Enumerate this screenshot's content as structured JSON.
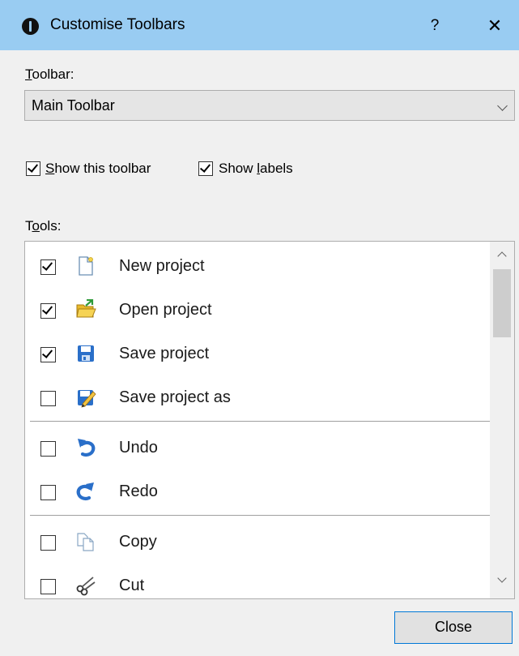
{
  "window": {
    "title": "Customise Toolbars",
    "help_label": "?",
    "close_glyph": "✕"
  },
  "toolbar_label": {
    "first": "T",
    "rest": "oolbar:"
  },
  "toolbar_select": {
    "value": "Main Toolbar"
  },
  "options": {
    "show_toolbar": {
      "first": "S",
      "rest": "how this toolbar",
      "checked": true
    },
    "show_labels": {
      "pre": "Show ",
      "accel": "l",
      "post": "abels",
      "checked": true
    }
  },
  "tools_label": {
    "pre": "T",
    "accel": "o",
    "post": "ols:"
  },
  "tools": [
    {
      "label": "New project",
      "checked": true,
      "icon": "new-project-icon"
    },
    {
      "label": "Open project",
      "checked": true,
      "icon": "open-project-icon"
    },
    {
      "label": "Save project",
      "checked": true,
      "icon": "save-project-icon"
    },
    {
      "label": "Save project as",
      "checked": false,
      "icon": "save-as-icon"
    },
    {
      "label": "Undo",
      "checked": false,
      "icon": "undo-icon"
    },
    {
      "label": "Redo",
      "checked": false,
      "icon": "redo-icon"
    },
    {
      "label": "Copy",
      "checked": false,
      "icon": "copy-icon"
    },
    {
      "label": "Cut",
      "checked": false,
      "icon": "cut-icon"
    }
  ],
  "buttons": {
    "close": "Close"
  },
  "colors": {
    "titlebar": "#99ccf2",
    "focus_border": "#0078d7",
    "undo_redo_blue": "#2a6fc9"
  }
}
